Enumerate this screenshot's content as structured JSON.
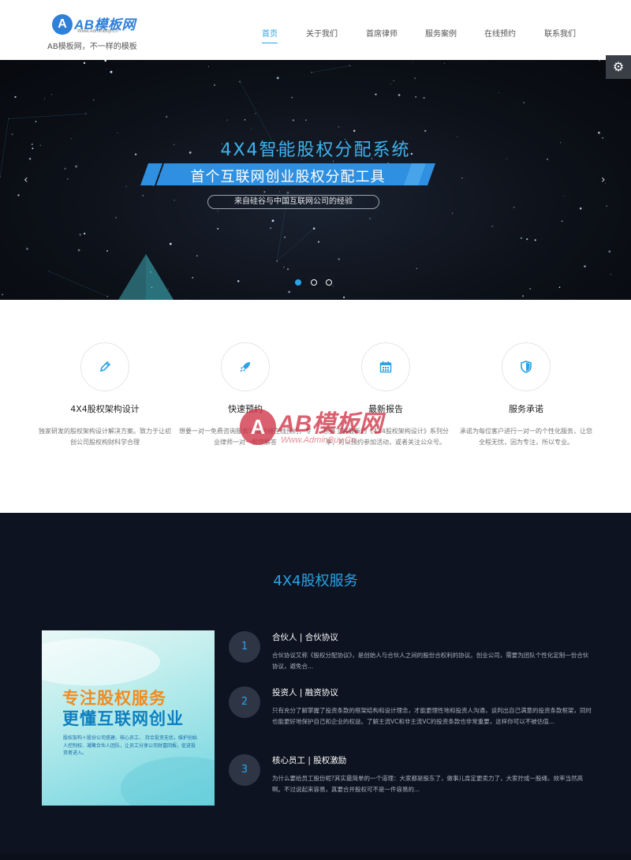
{
  "header": {
    "logo_mark": "A",
    "logo_text": "AB模板网",
    "logo_url": "Www.AdminBuy.Cn",
    "slogan": "AB模板网，不一样的模板",
    "nav": [
      {
        "label": "首页",
        "active": true
      },
      {
        "label": "关于我们",
        "active": false
      },
      {
        "label": "首席律师",
        "active": false
      },
      {
        "label": "服务案例",
        "active": false
      },
      {
        "label": "在线预约",
        "active": false
      },
      {
        "label": "联系我们",
        "active": false
      }
    ]
  },
  "banner": {
    "title": "4X4智能股权分配系统",
    "ribbon": "首个互联网创业股权分配工具",
    "pill": "来自硅谷与中国互联网公司的经验",
    "prev_arrow": "‹",
    "next_arrow": "›",
    "slide_count": 3,
    "active_slide": 1
  },
  "settings_icon": "gear-icon",
  "features": [
    {
      "icon": "pencil-icon",
      "title": "4X4股权架构设计",
      "desc": "独家研发的股权架构设计解决方案。致力于让初创公司股权构财科学合理"
    },
    {
      "icon": "rocket-icon",
      "title": "快速预约",
      "desc": "想要一对一免费咨询服务？请直接在线预约，专业律师一对一帮您解答"
    },
    {
      "icon": "calendar-icon",
      "title": "最新报告",
      "desc": "想要了解最新的《4X4股权架构设计》系列分享，可以预约参加活动，或者关注公众号。"
    },
    {
      "icon": "shield-icon",
      "title": "服务承诺",
      "desc": "承诺为每位客户进行一对一的个性化服务，让您全程无忧，因为专注，所以专业。"
    }
  ],
  "watermark": {
    "mark": "A",
    "text": "AB模板网",
    "url": "Www.AdminBuy.Cn"
  },
  "services": {
    "title": "4X4股权服务",
    "poster": {
      "line1": "专注股权服务",
      "line2": "更懂互联网创业",
      "small": "股权架构＋股份公司搭建、核心员工、 持合投资无忧，维护创始人控制权、凝聚合伙人团队，让员工分享公司财富回报，促进投资者进入。"
    },
    "items": [
      {
        "num": "1",
        "title": "合伙人 | 合伙协议",
        "desc": "合伙协议又称《股权分配协议》，是创始人与合伙人之间的股份合权利的协议。创业公司，需要为团队个性化定制一份合伙协议，避免合..."
      },
      {
        "num": "2",
        "title": "投资人 | 融资协议",
        "desc": "只有充分了解掌握了投资条款的框架结构和设计理念，才能更理性地和投资人沟通，谈判出自己满意的投资条款框架，同时也能更好地保护自己和企业的权益。了解主流VC和非主流VC的投资条款也非常重要，这样你可以不被估值..."
      },
      {
        "num": "3",
        "title": "核心员工 | 股权激励",
        "desc": "为什么要给员工股份呢?其实最简单的一个道理：大家都是股东了，做事儿肯定更卖力了，大家拧成一股绳，效率当然高啊。不过说起来容易，真要合并股权可不是一件容易的..."
      }
    ]
  },
  "colors": {
    "accent": "#2aa3e6",
    "dark_bg": "#0d1320",
    "watermark_red": "#cf2b3f"
  }
}
